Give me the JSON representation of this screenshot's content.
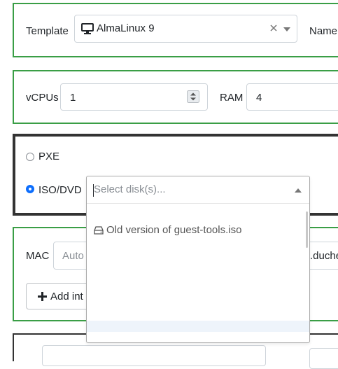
{
  "template_panel": {
    "label": "Template",
    "selected": "AlmaLinux 9",
    "name_label": "Name"
  },
  "resources_panel": {
    "vcpus_label": "vCPUs",
    "vcpus_value": "1",
    "ram_label": "RAM",
    "ram_value": "4"
  },
  "boot_panel": {
    "pxe_label": "PXE",
    "iso_label": "ISO/DVD",
    "selected_option": "ISO/DVD",
    "disk_select_placeholder": "Select disk(s)..."
  },
  "disk_dropdown": {
    "options": [
      "Old version of guest-tools.iso"
    ]
  },
  "network_panel": {
    "mac_label": "MAC",
    "mac_placeholder": "Auto",
    "network_fragment": ".duche",
    "add_button_label": "Add int"
  },
  "colors": {
    "panel_border": "#3a9e46",
    "focus_border": "#333333",
    "radio_selected": "#0d6efd"
  }
}
